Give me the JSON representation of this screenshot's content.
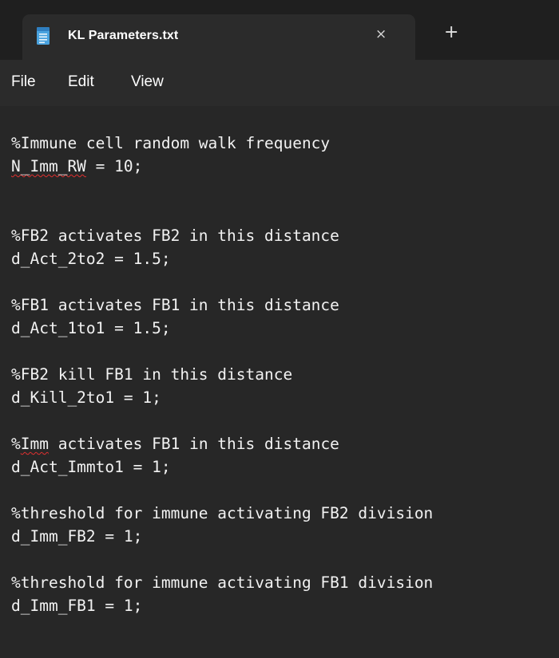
{
  "window": {
    "tab_title": "KL Parameters.txt",
    "close_glyph": "×",
    "new_tab_glyph": "+",
    "icon": "notepad-icon"
  },
  "menu": {
    "file": "File",
    "edit": "Edit",
    "view": "View"
  },
  "document": {
    "lines": [
      "%Immune cell random walk frequency",
      "N_Imm_RW = 10;",
      "",
      "",
      "%FB2 activates FB2 in this distance",
      "d_Act_2to2 = 1.5;",
      "",
      "%FB1 activates FB1 in this distance",
      "d_Act_1to1 = 1.5;",
      "",
      "%FB2 kill FB1 in this distance",
      "d_Kill_2to1 = 1;",
      "",
      "%Imm activates FB1 in this distance",
      "d_Act_Immto1 = 1;",
      "",
      "%threshold for immune activating FB2 division",
      "d_Imm_FB2 = 1;",
      "",
      "%threshold for immune activating FB1 division",
      "d_Imm_FB1 = 1;"
    ],
    "spellcheck_words": [
      "N_Imm_RW",
      "Imm"
    ]
  },
  "colors": {
    "titlebar_bg": "#1f1f1f",
    "tab_bg": "#2b2b2b",
    "editor_bg": "#272727",
    "text": "#f2f2f2",
    "spellcheck_underline": "#e03030"
  }
}
